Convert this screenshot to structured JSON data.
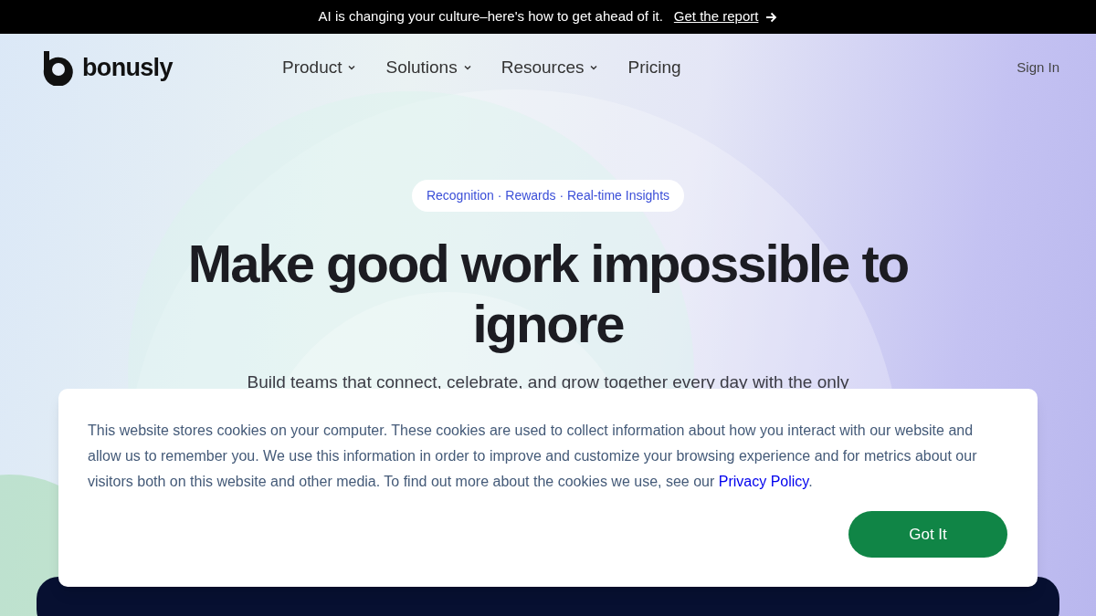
{
  "announcement": {
    "text": "AI is changing your culture–here's how to get ahead of it.",
    "link": "Get the report"
  },
  "header": {
    "logo": "bonusly",
    "nav": [
      {
        "label": "Product",
        "dropdown": true
      },
      {
        "label": "Solutions",
        "dropdown": true
      },
      {
        "label": "Resources",
        "dropdown": true
      },
      {
        "label": "Pricing",
        "dropdown": false
      }
    ],
    "sign_in": "Sign In"
  },
  "hero": {
    "tagline": "Recognition · Rewards · Real-time Insights",
    "title": "Make good work impossible to ignore",
    "subtitle": "Build teams that connect, celebrate, and grow together every day with the only"
  },
  "cookie_banner": {
    "text": "This website stores cookies on your computer. These cookies are used to collect information about how you interact with our website and allow us to remember you. We use this information in order to improve and customize your browsing experience and for metrics about our visitors both on this website and other media. To find out more about the cookies we use, see our ",
    "link": "Privacy Policy",
    "text_end": ".",
    "button": "Got It"
  }
}
